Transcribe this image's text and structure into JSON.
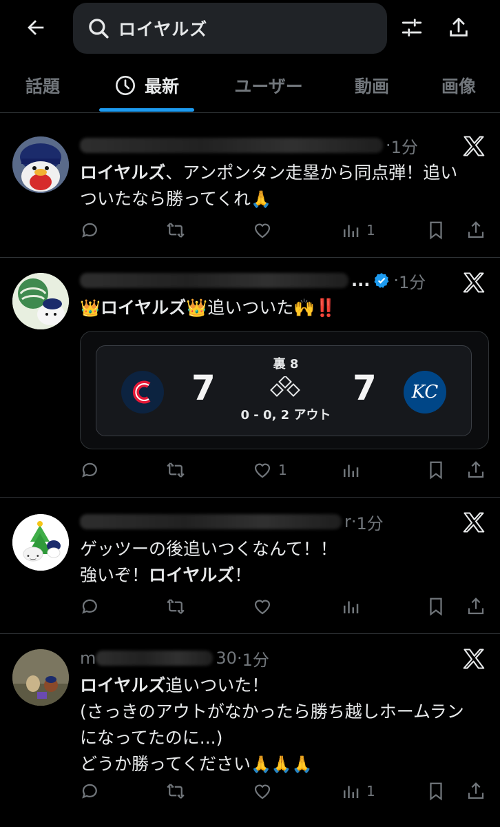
{
  "search": {
    "query": "ロイヤルズ"
  },
  "tabs": [
    {
      "label": "話題"
    },
    {
      "label": "最新"
    },
    {
      "label": "ユーザー"
    },
    {
      "label": "動画"
    },
    {
      "label": "画像"
    }
  ],
  "posts": [
    {
      "time": "1分",
      "text_bold": "ロイヤルズ",
      "text": "、アンポンタン走塁から同点弾！追い\nついたなら勝ってくれ",
      "emoji": "🙏",
      "replies": "",
      "reposts": "",
      "likes": "",
      "views": "1"
    },
    {
      "time": "1分",
      "text_bold": "ロイヤルズ",
      "text_pre": "👑",
      "text_post": "👑追いついた🙌‼️",
      "likes": "1",
      "views": "",
      "game": {
        "away_score": "7",
        "home_score": "7",
        "inning": "裏 8",
        "count": "0 - 0, 2 アウト",
        "away_color": "#0c2340",
        "home_color": "#004687",
        "home_logo_text": "KC"
      }
    },
    {
      "name_suffix": "r",
      "time": "1分",
      "text_line1": "ゲッツーの後追いつくなんて！！",
      "text_line2_pre": "強いぞ！",
      "text_bold": "ロイヤルズ",
      "text_line2_post": "！"
    },
    {
      "name_prefix": "m",
      "name_suffix": "30",
      "time": "1分",
      "text_bold": "ロイヤルズ",
      "text_line1_post": "追いついた！",
      "text_rest": "(さっきのアウトがなかったら勝ち越しホームラン\nになってたのに...)\nどうか勝ってください",
      "emoji": "🙏🙏🙏",
      "views": "1"
    }
  ],
  "colors": {
    "accent": "#1d9bf0",
    "verified": "#1d9bf0",
    "background": "#000000",
    "muted": "#71767b"
  }
}
